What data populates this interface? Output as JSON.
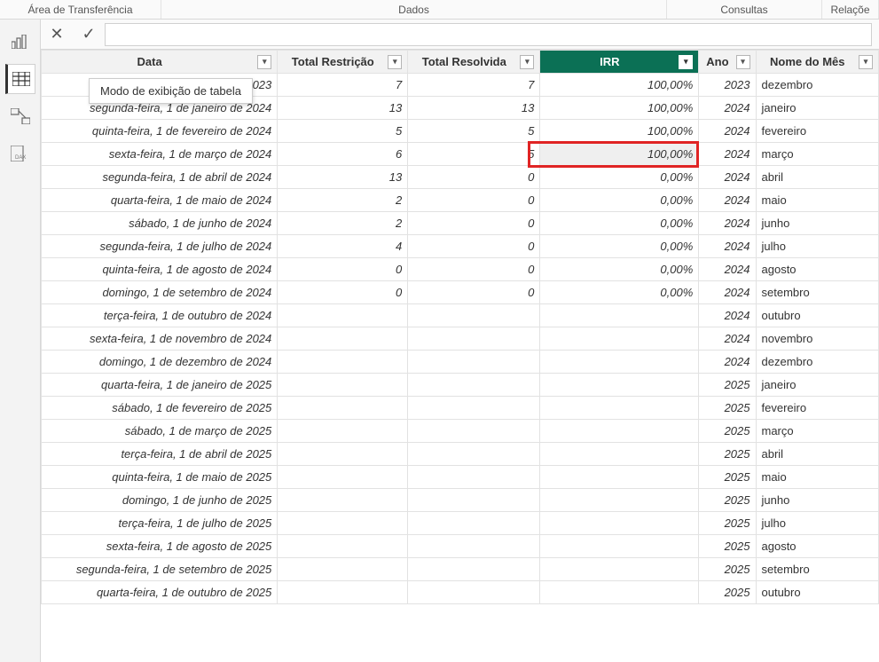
{
  "ribbon": {
    "transfer": "Área de Transferência",
    "dados": "Dados",
    "consultas": "Consultas",
    "relacoes": "Relaçõe"
  },
  "tooltip": "Modo de exibição de tabela",
  "formula": {
    "cancel_glyph": "✕",
    "confirm_glyph": "✓"
  },
  "columns": {
    "data": "Data",
    "total_restricao": "Total Restrição",
    "total_resolvida": "Total Resolvida",
    "irr": "IRR",
    "ano": "Ano",
    "nome_mes": "Nome do Mês"
  },
  "filter_glyph": "▾",
  "rows": [
    {
      "data": "023",
      "tr": "7",
      "trv": "7",
      "irr": "100,00%",
      "ano": "2023",
      "mes": "dezembro",
      "truncated": true
    },
    {
      "data": "segunda-feira, 1 de janeiro de 2024",
      "tr": "13",
      "trv": "13",
      "irr": "100,00%",
      "ano": "2024",
      "mes": "janeiro"
    },
    {
      "data": "quinta-feira, 1 de fevereiro de 2024",
      "tr": "5",
      "trv": "5",
      "irr": "100,00%",
      "ano": "2024",
      "mes": "fevereiro"
    },
    {
      "data": "sexta-feira, 1 de março de 2024",
      "tr": "6",
      "trv": "5",
      "irr": "100,00%",
      "ano": "2024",
      "mes": "março",
      "highlight": true
    },
    {
      "data": "segunda-feira, 1 de abril de 2024",
      "tr": "13",
      "trv": "0",
      "irr": "0,00%",
      "ano": "2024",
      "mes": "abril"
    },
    {
      "data": "quarta-feira, 1 de maio de 2024",
      "tr": "2",
      "trv": "0",
      "irr": "0,00%",
      "ano": "2024",
      "mes": "maio"
    },
    {
      "data": "sábado, 1 de junho de 2024",
      "tr": "2",
      "trv": "0",
      "irr": "0,00%",
      "ano": "2024",
      "mes": "junho"
    },
    {
      "data": "segunda-feira, 1 de julho de 2024",
      "tr": "4",
      "trv": "0",
      "irr": "0,00%",
      "ano": "2024",
      "mes": "julho"
    },
    {
      "data": "quinta-feira, 1 de agosto de 2024",
      "tr": "0",
      "trv": "0",
      "irr": "0,00%",
      "ano": "2024",
      "mes": "agosto"
    },
    {
      "data": "domingo, 1 de setembro de 2024",
      "tr": "0",
      "trv": "0",
      "irr": "0,00%",
      "ano": "2024",
      "mes": "setembro"
    },
    {
      "data": "terça-feira, 1 de outubro de 2024",
      "tr": "",
      "trv": "",
      "irr": "",
      "ano": "2024",
      "mes": "outubro"
    },
    {
      "data": "sexta-feira, 1 de novembro de 2024",
      "tr": "",
      "trv": "",
      "irr": "",
      "ano": "2024",
      "mes": "novembro"
    },
    {
      "data": "domingo, 1 de dezembro de 2024",
      "tr": "",
      "trv": "",
      "irr": "",
      "ano": "2024",
      "mes": "dezembro"
    },
    {
      "data": "quarta-feira, 1 de janeiro de 2025",
      "tr": "",
      "trv": "",
      "irr": "",
      "ano": "2025",
      "mes": "janeiro"
    },
    {
      "data": "sábado, 1 de fevereiro de 2025",
      "tr": "",
      "trv": "",
      "irr": "",
      "ano": "2025",
      "mes": "fevereiro"
    },
    {
      "data": "sábado, 1 de março de 2025",
      "tr": "",
      "trv": "",
      "irr": "",
      "ano": "2025",
      "mes": "março"
    },
    {
      "data": "terça-feira, 1 de abril de 2025",
      "tr": "",
      "trv": "",
      "irr": "",
      "ano": "2025",
      "mes": "abril"
    },
    {
      "data": "quinta-feira, 1 de maio de 2025",
      "tr": "",
      "trv": "",
      "irr": "",
      "ano": "2025",
      "mes": "maio"
    },
    {
      "data": "domingo, 1 de junho de 2025",
      "tr": "",
      "trv": "",
      "irr": "",
      "ano": "2025",
      "mes": "junho"
    },
    {
      "data": "terça-feira, 1 de julho de 2025",
      "tr": "",
      "trv": "",
      "irr": "",
      "ano": "2025",
      "mes": "julho"
    },
    {
      "data": "sexta-feira, 1 de agosto de 2025",
      "tr": "",
      "trv": "",
      "irr": "",
      "ano": "2025",
      "mes": "agosto"
    },
    {
      "data": "segunda-feira, 1 de setembro de 2025",
      "tr": "",
      "trv": "",
      "irr": "",
      "ano": "2025",
      "mes": "setembro"
    },
    {
      "data": "quarta-feira, 1 de outubro de 2025",
      "tr": "",
      "trv": "",
      "irr": "",
      "ano": "2025",
      "mes": "outubro"
    }
  ]
}
